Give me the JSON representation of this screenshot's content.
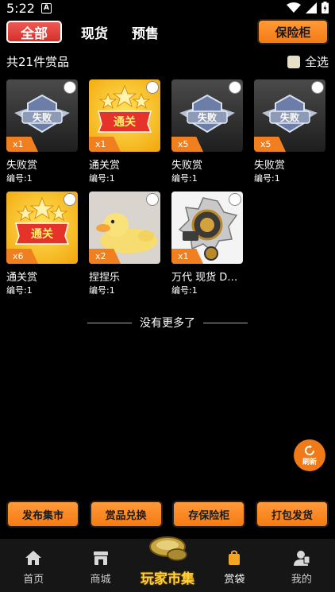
{
  "status_bar": {
    "time": "5:22",
    "notification_glyph": "A"
  },
  "tabs": {
    "all": "全部",
    "in_stock": "现货",
    "presale": "预售"
  },
  "vault_button": "保险柜",
  "summary": "共21件赏品",
  "select_all": "全选",
  "items": [
    {
      "name": "失败赏",
      "number": "编号:1",
      "qty": "x1",
      "art": "fail-badge"
    },
    {
      "name": "通关赏",
      "number": "编号:1",
      "qty": "x1",
      "art": "clear-badge"
    },
    {
      "name": "失败赏",
      "number": "编号:1",
      "qty": "x5",
      "art": "fail-badge"
    },
    {
      "name": "失败赏",
      "number": "编号:1",
      "qty": "x5",
      "art": "fail-badge"
    },
    {
      "name": "通关赏",
      "number": "编号:1",
      "qty": "x6",
      "art": "clear-badge"
    },
    {
      "name": "捏捏乐",
      "number": "编号:1",
      "qty": "x2",
      "art": "duck-toy"
    },
    {
      "name": "万代 现货 DX ...",
      "number": "编号:1",
      "qty": "x1",
      "art": "gear-toy"
    }
  ],
  "badge_text": {
    "fail": "失败",
    "clear": "通关"
  },
  "no_more": "没有更多了",
  "refresh": "刷新",
  "actions": [
    "发布集市",
    "赏品兑换",
    "存保险柜",
    "打包发货"
  ],
  "tabbar": {
    "home": "首页",
    "mall": "商城",
    "center": "玩家市集",
    "bag": "赏袋",
    "mine": "我的"
  },
  "colors": {
    "accent": "#f57a12",
    "active_tab": "#d5302a",
    "tabbar_bg": "#161616"
  }
}
